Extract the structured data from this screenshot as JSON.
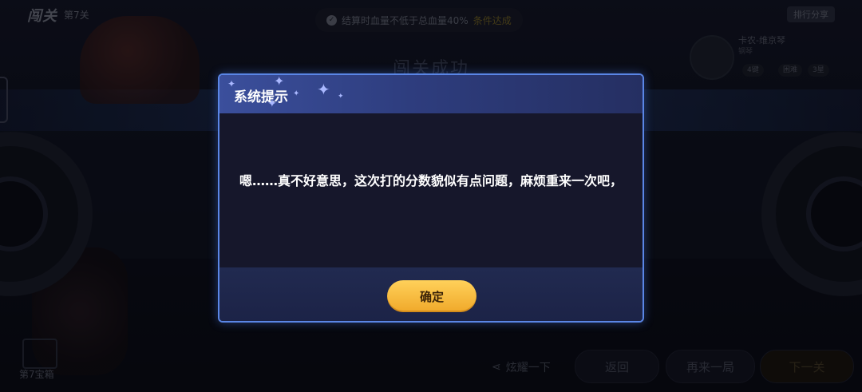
{
  "background": {
    "stage_title": "闯关",
    "stage_level": "第7关",
    "condition_text": "结算时血量不低于总血量40%",
    "condition_status": "条件达成",
    "share_tag": "排行分享",
    "result_title": "闯关成功",
    "song_name": "卡农-维京琴",
    "song_sub": "钢琴",
    "chips": [
      "4键",
      "困难",
      "3星"
    ],
    "chest_label": "第7宝箱",
    "share_label": "炫耀一下",
    "buttons": {
      "back": "返回",
      "retry": "再来一局",
      "next": "下一关"
    }
  },
  "dialog": {
    "title": "系统提示",
    "message": "嗯……真不好意思，这次打的分数貌似有点问题，麻烦重来一次吧，",
    "confirm_label": "确定"
  },
  "colors": {
    "dialog_border": "#5a86e6",
    "header_accent": "#3b4f9c",
    "confirm_button": "#f7bd3f"
  },
  "icons": [
    "check-circle-icon",
    "sparkle-icon",
    "share-icon",
    "treasure-chest-icon"
  ]
}
